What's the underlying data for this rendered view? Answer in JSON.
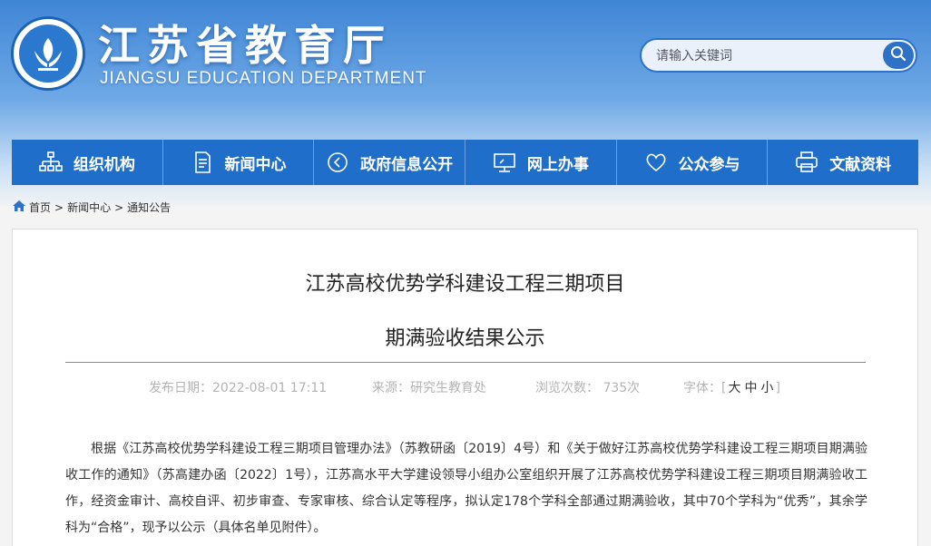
{
  "header": {
    "title": "江苏省教育厅",
    "subtitle": "JIANGSU EDUCATION DEPARTMENT",
    "logo_icon": "education-emblem-icon"
  },
  "search": {
    "placeholder": "请输入关键词",
    "button_icon": "search-icon"
  },
  "nav": {
    "items": [
      {
        "label": "组织机构",
        "icon": "org-chart-icon"
      },
      {
        "label": "新闻中心",
        "icon": "document-icon"
      },
      {
        "label": "政府信息公开",
        "icon": "open-info-icon"
      },
      {
        "label": "网上办事",
        "icon": "monitor-icon"
      },
      {
        "label": "公众参与",
        "icon": "heart-icon"
      },
      {
        "label": "文献资料",
        "icon": "printer-icon"
      }
    ]
  },
  "breadcrumb": {
    "home": "首页",
    "section": "新闻中心",
    "current": "通知公告"
  },
  "article": {
    "title_line1": "江苏高校优势学科建设工程三期项目",
    "title_line2": "期满验收结果公示",
    "publish_label": "发布日期：2022-08-01 17:11",
    "source_label": "来源：研究生教育处",
    "views_label": "浏览次数： 735次",
    "font_label": "字体：",
    "font_large": "大",
    "font_medium": "中",
    "font_small": "小",
    "body": "根据《江苏高校优势学科建设工程三期项目管理办法》（苏教研函〔2019〕4号）和《关于做好江苏高校优势学科建设工程三期项目期满验收工作的通知》（苏高建办函〔2022〕1号），江苏高水平大学建设领导小组办公室组织开展了江苏高校优势学科建设工程三期项目期满验收工作，经资金审计、高校自评、初步审查、专家审核、综合认定等程序，拟认定178个学科全部通过期满验收，其中70个学科为“优秀”，其余学科为“合格”，现予以公示（具体名单见附件）。"
  },
  "colors": {
    "nav_bg": "#1f6ec9",
    "header_blue": "#3f86d6",
    "meta_gray": "#b3b3b3"
  }
}
